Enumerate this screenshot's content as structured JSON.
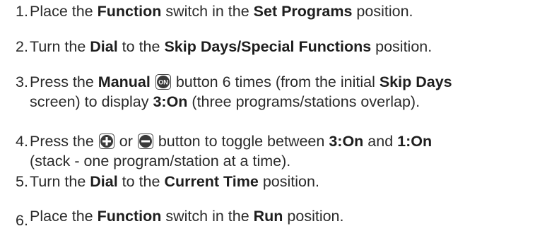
{
  "steps": [
    {
      "num": "1.",
      "lines": [
        [
          {
            "t": "Place the "
          },
          {
            "t": "Function",
            "b": true
          },
          {
            "t": " switch in the "
          },
          {
            "t": "Set Programs",
            "b": true
          },
          {
            "t": " position."
          }
        ]
      ]
    },
    {
      "num": "2.",
      "lines": [
        [
          {
            "t": "Turn the "
          },
          {
            "t": "Dial",
            "b": true
          },
          {
            "t": " to the "
          },
          {
            "t": "Skip Days/Special Functions",
            "b": true
          },
          {
            "t": " position."
          }
        ]
      ]
    },
    {
      "num": "3.",
      "lines": [
        [
          {
            "t": "Press the "
          },
          {
            "t": "Manual",
            "b": true
          },
          {
            "t": " "
          },
          {
            "icon": "manual-on-button-icon",
            "label": "ON"
          },
          {
            "t": " button 6 times (from the initial "
          },
          {
            "t": "Skip Days",
            "b": true
          }
        ],
        [
          {
            "t": "screen) to display "
          },
          {
            "t": "3:On",
            "b": true
          },
          {
            "t": " (three programs/stations overlap)."
          }
        ]
      ]
    },
    {
      "num": "4.",
      "lines": [
        [
          {
            "t": "Press the "
          },
          {
            "icon": "plus-button-icon"
          },
          {
            "t": " or "
          },
          {
            "icon": "minus-button-icon"
          },
          {
            "t": " button to toggle between "
          },
          {
            "t": "3:On",
            "b": true
          },
          {
            "t": " and "
          },
          {
            "t": "1:On",
            "b": true
          }
        ],
        [
          {
            "t": "(stack - one program/station at a time)."
          }
        ]
      ]
    },
    {
      "num": "5.",
      "lines": [
        [
          {
            "t": "Turn the "
          },
          {
            "t": "Dial",
            "b": true
          },
          {
            "t": " to the "
          },
          {
            "t": "Current Time",
            "b": true
          },
          {
            "t": " position."
          }
        ]
      ]
    },
    {
      "num": "6.",
      "lines": [
        [
          {
            "t": "Place the "
          },
          {
            "t": "Function",
            "b": true
          },
          {
            "t": " switch in the "
          },
          {
            "t": "Run",
            "b": true
          },
          {
            "t": " position."
          }
        ]
      ]
    }
  ]
}
